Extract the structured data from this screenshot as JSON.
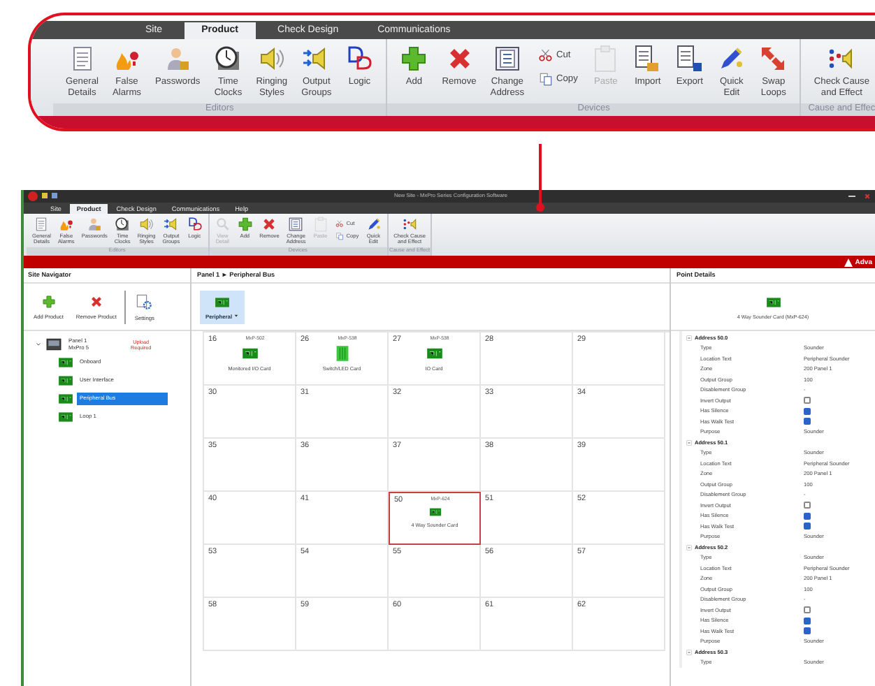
{
  "callout": {
    "tabs": [
      {
        "label": "Site",
        "selected": false
      },
      {
        "label": "Product",
        "selected": true
      },
      {
        "label": "Check Design",
        "selected": false
      },
      {
        "label": "Communications",
        "selected": false
      }
    ],
    "groups": [
      {
        "label": "Editors",
        "items": [
          {
            "label": "General\nDetails",
            "disabled": false
          },
          {
            "label": "False\nAlarms",
            "disabled": false
          },
          {
            "label": "Passwords",
            "disabled": false
          },
          {
            "label": "Time\nClocks",
            "disabled": false
          },
          {
            "label": "Ringing\nStyles",
            "disabled": false
          },
          {
            "label": "Output\nGroups",
            "disabled": false
          },
          {
            "label": "Logic",
            "disabled": false
          }
        ]
      },
      {
        "label": "Devices",
        "items": [
          {
            "label": "Add",
            "disabled": false
          },
          {
            "label": "Remove",
            "disabled": false
          },
          {
            "label": "Change\nAddress",
            "disabled": false
          },
          {
            "kind": "stack",
            "items": [
              {
                "label": "Cut",
                "disabled": false
              },
              {
                "label": "Copy",
                "disabled": false
              }
            ]
          },
          {
            "label": "Paste",
            "disabled": true
          },
          {
            "label": "Import",
            "disabled": false
          },
          {
            "label": "Export",
            "disabled": false
          },
          {
            "label": "Quick\nEdit",
            "disabled": false
          },
          {
            "label": "Swap\nLoops",
            "disabled": false
          }
        ]
      },
      {
        "label": "Cause and Effec",
        "items": [
          {
            "label": "Check Cause\nand Effect",
            "disabled": false
          }
        ]
      }
    ]
  },
  "window": {
    "title": "New Site - MxPro Series Configuration Software"
  },
  "ribbon": {
    "tabs": [
      {
        "label": "Site",
        "selected": false
      },
      {
        "label": "Product",
        "selected": true
      },
      {
        "label": "Check Design",
        "selected": false
      },
      {
        "label": "Communications",
        "selected": false
      },
      {
        "label": "Help",
        "selected": false
      }
    ],
    "groups": [
      {
        "label": "Editors",
        "items": [
          {
            "label": "General\nDetails",
            "disabled": false
          },
          {
            "label": "False\nAlarms",
            "disabled": false
          },
          {
            "label": "Passwords",
            "disabled": false
          },
          {
            "label": "Time\nClocks",
            "disabled": false
          },
          {
            "label": "Ringing\nStyles",
            "disabled": false
          },
          {
            "label": "Output\nGroups",
            "disabled": false
          },
          {
            "label": "Logic",
            "disabled": false
          }
        ]
      },
      {
        "label": "Devices",
        "items": [
          {
            "label": "View\nDetail",
            "disabled": true
          },
          {
            "label": "Add",
            "disabled": false
          },
          {
            "label": "Remove",
            "disabled": false
          },
          {
            "label": "Change\nAddress",
            "disabled": false
          },
          {
            "label": "Paste",
            "disabled": true
          },
          {
            "kind": "stack",
            "items": [
              {
                "label": "Cut",
                "disabled": false
              },
              {
                "label": "Copy",
                "disabled": false
              }
            ]
          },
          {
            "label": "Quick\nEdit",
            "disabled": false
          }
        ]
      },
      {
        "label": "Cause and Effect",
        "items": [
          {
            "label": "Check Cause\nand Effect",
            "disabled": false
          }
        ]
      }
    ]
  },
  "banner": {
    "text": "Adva"
  },
  "navigator": {
    "title": "Site Navigator",
    "tools": [
      "Add Product",
      "Remove Product",
      "Settings"
    ],
    "tree": [
      {
        "label": "Panel 1",
        "sublabel": "MxPro 5",
        "status": "Upload\nRequired",
        "selected": false,
        "children": [
          {
            "label": "Onboard",
            "selected": false
          },
          {
            "label": "User Interface",
            "selected": false
          },
          {
            "label": "Peripheral Bus",
            "selected": true
          },
          {
            "label": "Loop 1",
            "selected": false
          }
        ]
      }
    ]
  },
  "bus": {
    "title": "Panel 1 ► Peripheral Bus",
    "filter": "Peripheral",
    "cells": [
      {
        "number": "16",
        "selected": false,
        "card": {
          "part": "MxP-502",
          "name": "Monitored I/O Card"
        }
      },
      {
        "number": "26",
        "selected": false,
        "card": {
          "part": "MxP-538",
          "name": "Switch/LED Card"
        }
      },
      {
        "number": "27",
        "selected": false,
        "card": {
          "part": "MxP-538",
          "name": "IO Card"
        }
      },
      {
        "number": "28",
        "selected": false
      },
      {
        "number": "29",
        "selected": false
      },
      {
        "number": "30",
        "selected": false
      },
      {
        "number": "31",
        "selected": false
      },
      {
        "number": "32",
        "selected": false
      },
      {
        "number": "33",
        "selected": false
      },
      {
        "number": "34",
        "selected": false
      },
      {
        "number": "35",
        "selected": false
      },
      {
        "number": "36",
        "selected": false
      },
      {
        "number": "37",
        "selected": false
      },
      {
        "number": "38",
        "selected": false
      },
      {
        "number": "39",
        "selected": false
      },
      {
        "number": "40",
        "selected": false
      },
      {
        "number": "41",
        "selected": false
      },
      {
        "number": "50",
        "selected": true,
        "card": {
          "part": "MxP-624",
          "name": "4 Way Sounder Card"
        }
      },
      {
        "number": "51",
        "selected": false
      },
      {
        "number": "52",
        "selected": false
      },
      {
        "number": "53",
        "selected": false
      },
      {
        "number": "54",
        "selected": false
      },
      {
        "number": "55",
        "selected": false
      },
      {
        "number": "56",
        "selected": false
      },
      {
        "number": "57",
        "selected": false
      },
      {
        "number": "58",
        "selected": false
      },
      {
        "number": "59",
        "selected": false
      },
      {
        "number": "60",
        "selected": false
      },
      {
        "number": "61",
        "selected": false
      },
      {
        "number": "62",
        "selected": false
      }
    ]
  },
  "details": {
    "title": "Point Details",
    "device": "4 Way Sounder Card (MxP-624)",
    "addresses": [
      {
        "label": "Address 50.0",
        "properties": [
          {
            "kind": "text",
            "name": "Type",
            "value": "Sounder"
          },
          {
            "kind": "text",
            "name": "Location Text",
            "value": "Peripheral Sounder"
          },
          {
            "kind": "text",
            "name": "Zone",
            "value": "200  Panel 1"
          },
          {
            "kind": "text",
            "name": "Output Group",
            "value": "100"
          },
          {
            "kind": "text",
            "name": "Disablement Group",
            "value": "-"
          },
          {
            "kind": "checkbox",
            "name": "Invert Output",
            "checked": false
          },
          {
            "kind": "checkbox",
            "name": "Has Silence",
            "checked": true
          },
          {
            "kind": "checkbox",
            "name": "Has Walk Test",
            "checked": true
          },
          {
            "kind": "text",
            "name": "Purpose",
            "value": "Sounder"
          }
        ]
      },
      {
        "label": "Address 50.1",
        "properties": [
          {
            "kind": "text",
            "name": "Type",
            "value": "Sounder"
          },
          {
            "kind": "text",
            "name": "Location Text",
            "value": "Peripheral Sounder"
          },
          {
            "kind": "text",
            "name": "Zone",
            "value": "200  Panel 1"
          },
          {
            "kind": "text",
            "name": "Output Group",
            "value": "100"
          },
          {
            "kind": "text",
            "name": "Disablement Group",
            "value": "-"
          },
          {
            "kind": "checkbox",
            "name": "Invert Output",
            "checked": false
          },
          {
            "kind": "checkbox",
            "name": "Has Silence",
            "checked": true
          },
          {
            "kind": "checkbox",
            "name": "Has Walk Test",
            "checked": true
          },
          {
            "kind": "text",
            "name": "Purpose",
            "value": "Sounder"
          }
        ]
      },
      {
        "label": "Address 50.2",
        "properties": [
          {
            "kind": "text",
            "name": "Type",
            "value": "Sounder"
          },
          {
            "kind": "text",
            "name": "Location Text",
            "value": "Peripheral Sounder"
          },
          {
            "kind": "text",
            "name": "Zone",
            "value": "200  Panel 1"
          },
          {
            "kind": "text",
            "name": "Output Group",
            "value": "100"
          },
          {
            "kind": "text",
            "name": "Disablement Group",
            "value": "-"
          },
          {
            "kind": "checkbox",
            "name": "Invert Output",
            "checked": false
          },
          {
            "kind": "checkbox",
            "name": "Has Silence",
            "checked": true
          },
          {
            "kind": "checkbox",
            "name": "Has Walk Test",
            "checked": true
          },
          {
            "kind": "text",
            "name": "Purpose",
            "value": "Sounder"
          }
        ]
      },
      {
        "label": "Address 50.3",
        "properties": [
          {
            "kind": "text",
            "name": "Type",
            "value": "Sounder"
          }
        ]
      }
    ]
  }
}
